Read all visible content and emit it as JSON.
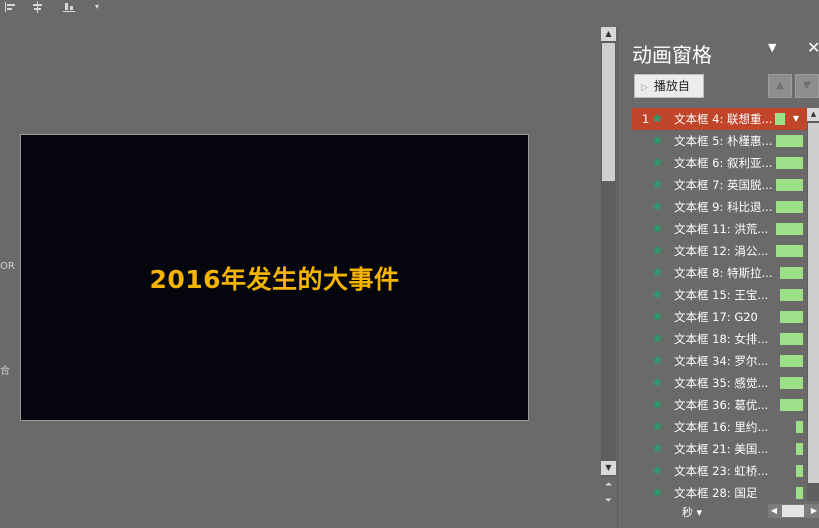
{
  "toolbar": {
    "icons": [
      "align-left-icon",
      "align-center-icon",
      "align-bottom-icon",
      "dropdown-icon"
    ]
  },
  "edge": {
    "text1": "OR",
    "text2": "合"
  },
  "slide": {
    "title": "2016年发生的大事件",
    "title_color": "#f5b400",
    "background": "#05050d"
  },
  "pane": {
    "title": "动画窗格",
    "play_label": "播放自",
    "seconds_label": "秒",
    "items": [
      {
        "num": "1",
        "label": "文本框 4: 联想重...",
        "selected": true,
        "bar": "short"
      },
      {
        "num": "",
        "label": "文本框 5: 朴槿惠...",
        "selected": false,
        "bar": "wide"
      },
      {
        "num": "",
        "label": "文本框 6: 叙利亚...",
        "selected": false,
        "bar": "wide"
      },
      {
        "num": "",
        "label": "文本框 7: 英国脱...",
        "selected": false,
        "bar": "wide"
      },
      {
        "num": "",
        "label": "文本框 9: 科比退...",
        "selected": false,
        "bar": "wide"
      },
      {
        "num": "",
        "label": "文本框 11: 洪荒...",
        "selected": false,
        "bar": "wide"
      },
      {
        "num": "",
        "label": "文本框 12: 涓公...",
        "selected": false,
        "bar": "wide"
      },
      {
        "num": "",
        "label": "文本框 8: 特斯拉...",
        "selected": false,
        "bar": "mid"
      },
      {
        "num": "",
        "label": "文本框 15: 王宝...",
        "selected": false,
        "bar": "mid"
      },
      {
        "num": "",
        "label": "文本框 17: G20",
        "selected": false,
        "bar": "mid"
      },
      {
        "num": "",
        "label": "文本框 18: 女排...",
        "selected": false,
        "bar": "mid"
      },
      {
        "num": "",
        "label": "文本框 34: 罗尔...",
        "selected": false,
        "bar": "mid"
      },
      {
        "num": "",
        "label": "文本框 35: 感觉...",
        "selected": false,
        "bar": "mid"
      },
      {
        "num": "",
        "label": "文本框 36: 葛优...",
        "selected": false,
        "bar": "mid"
      },
      {
        "num": "",
        "label": "文本框 16: 里约...",
        "selected": false,
        "bar": "tiny"
      },
      {
        "num": "",
        "label": "文本框 21: 美国...",
        "selected": false,
        "bar": "tiny"
      },
      {
        "num": "",
        "label": "文本框 23: 虹桥...",
        "selected": false,
        "bar": "tiny"
      },
      {
        "num": "",
        "label": "文本框 28: 国足",
        "selected": false,
        "bar": "tiny"
      }
    ]
  }
}
